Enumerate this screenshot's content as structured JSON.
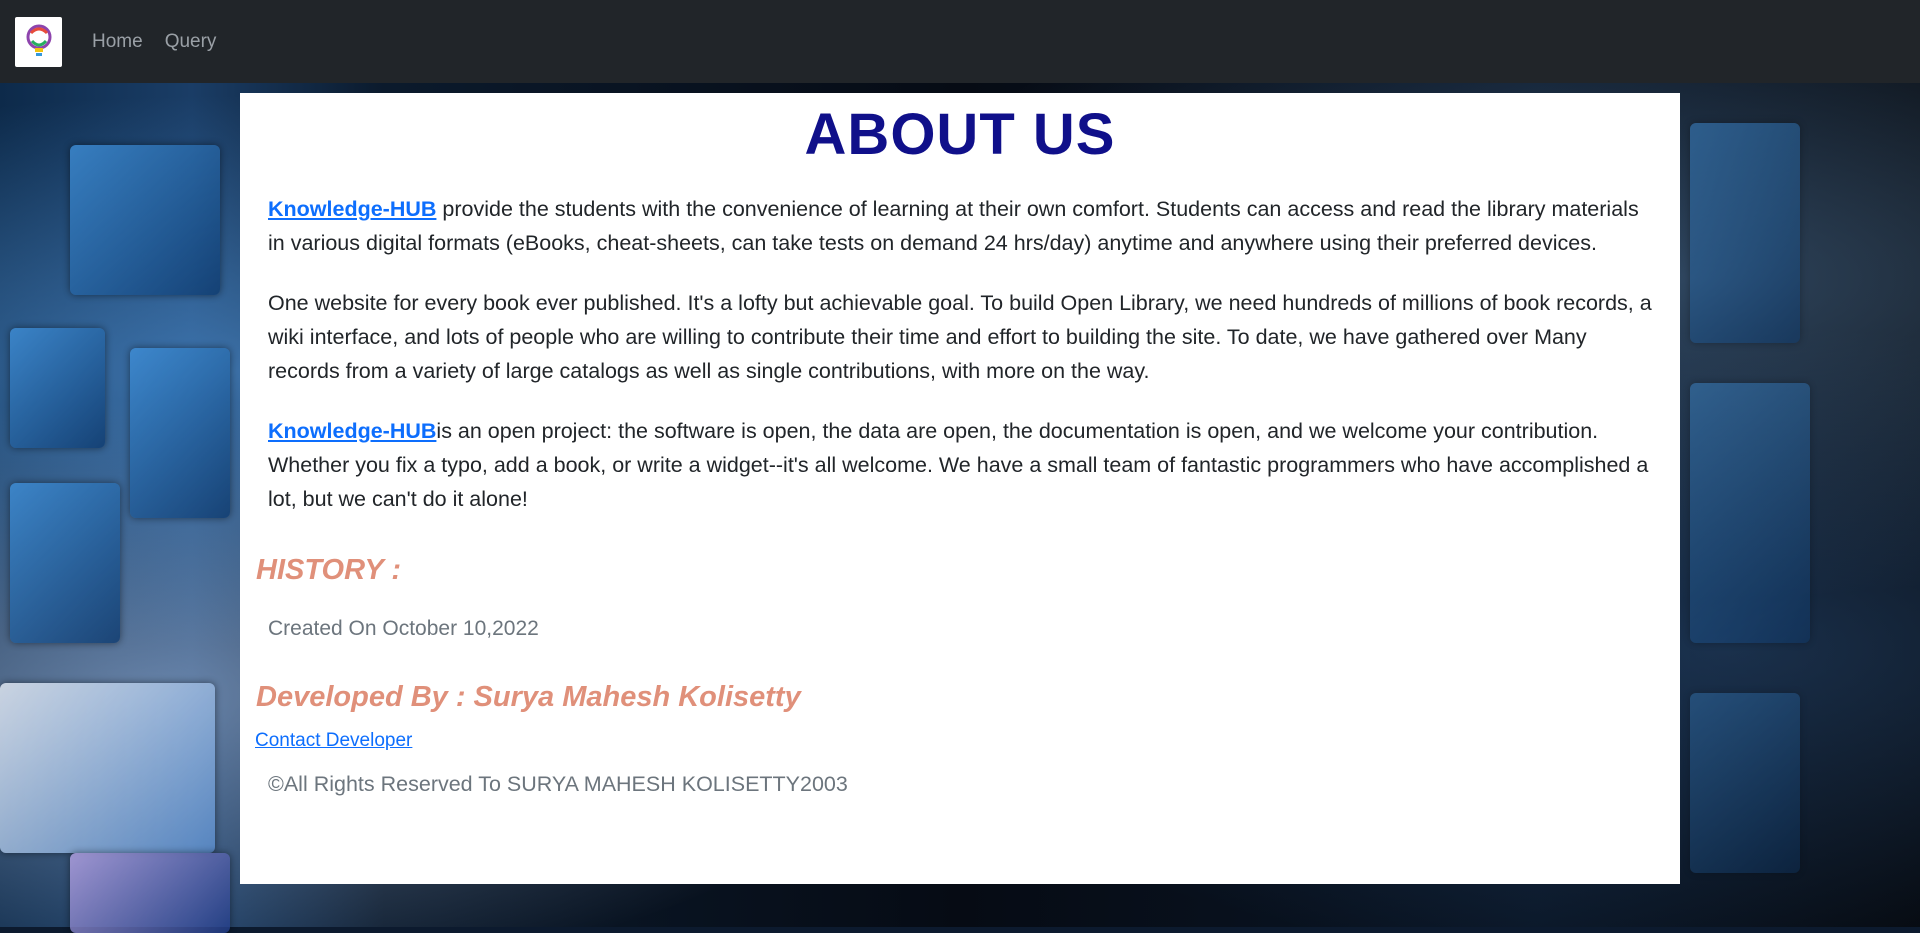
{
  "navbar": {
    "links": [
      "Home",
      "Query"
    ]
  },
  "main": {
    "title": "ABOUT US",
    "para1": {
      "link": "Knowledge-HUB",
      "text": " provide the students with the convenience of learning at their own comfort. Students can access and read the library materials in various digital formats (eBooks, cheat-sheets, can take tests on demand 24 hrs/day) anytime and anywhere using their preferred devices."
    },
    "para2": {
      "text": "One website for every book ever published. It's a lofty but achievable goal. To build Open Library, we need hundreds of millions of book records, a wiki interface, and lots of people who are willing to contribute their time and effort to building the site. To date, we have gathered over Many records from a variety of large catalogs as well as single contributions, with more on the way."
    },
    "para3": {
      "link": "Knowledge-HUB",
      "text": "is an open project: the software is open, the data are open, the documentation is open, and we welcome your contribution. Whether you fix a typo, add a book, or write a widget--it's all welcome. We have a small team of fantastic programmers who have accomplished a lot, but we can't do it alone!"
    },
    "history_heading": "HISTORY :",
    "created_text": "Created On October 10,2022",
    "developer_heading": "Developed By : Surya Mahesh Kolisetty",
    "contact_link": "Contact Developer",
    "rights_text": "©All Rights Reserved To SURYA MAHESH KOLISETTY2003"
  },
  "colors": {
    "navbar_bg": "#212529",
    "title": "#10108a",
    "link": "#0d6efd",
    "heading_orange": "#e0907a",
    "muted": "#6c757d"
  }
}
